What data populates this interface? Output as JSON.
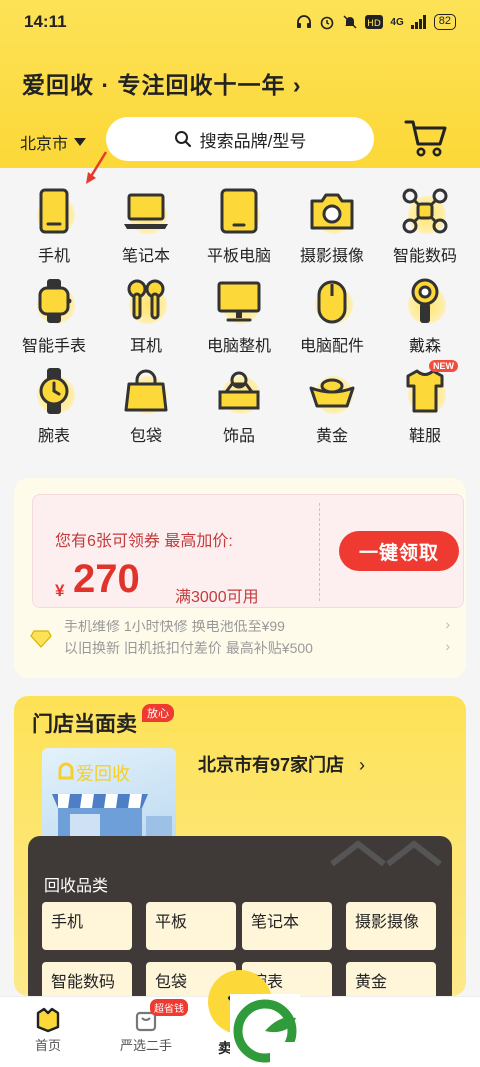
{
  "status_bar": {
    "time": "14:11",
    "network": "4G",
    "battery": "82"
  },
  "header": {
    "slogan": "爱回收 · 专注回收十一年 ›",
    "city": "北京市",
    "search_placeholder": "搜索品牌/型号"
  },
  "categories": [
    {
      "label": "手机",
      "icon": "phone-icon"
    },
    {
      "label": "笔记本",
      "icon": "laptop-icon"
    },
    {
      "label": "平板电脑",
      "icon": "tablet-icon"
    },
    {
      "label": "摄影摄像",
      "icon": "camera-icon"
    },
    {
      "label": "智能数码",
      "icon": "drone-icon"
    },
    {
      "label": "智能手表",
      "icon": "smartwatch-icon"
    },
    {
      "label": "耳机",
      "icon": "earbuds-icon"
    },
    {
      "label": "电脑整机",
      "icon": "desktop-icon"
    },
    {
      "label": "电脑配件",
      "icon": "mouse-icon"
    },
    {
      "label": "戴森",
      "icon": "hairdryer-icon"
    },
    {
      "label": "腕表",
      "icon": "wristwatch-icon"
    },
    {
      "label": "包袋",
      "icon": "handbag-icon"
    },
    {
      "label": "饰品",
      "icon": "ring-box-icon"
    },
    {
      "label": "黄金",
      "icon": "gold-ingot-icon"
    },
    {
      "label": "鞋服",
      "icon": "shirt-icon",
      "badge": "NEW"
    }
  ],
  "coupon": {
    "line1": "您有6张可领券 最高加价:",
    "currency": "¥",
    "amount": "270",
    "condition": "满3000可用",
    "button": "一键领取"
  },
  "ticker": [
    "手机维修 1小时快修 换电池低至¥99",
    "以旧换新 旧机抵扣付差价 最高补贴¥500"
  ],
  "store": {
    "title": "门店当面卖",
    "badge": "放心",
    "image_logo": "爱回收",
    "count_text": "北京市有97家门店",
    "chevron": "›",
    "panel_label": "回收品类",
    "chips": [
      "手机",
      "平板",
      "笔记本",
      "摄影摄像",
      "智能数码",
      "包袋",
      "腕表",
      "黄金"
    ]
  },
  "tabbar": {
    "tabs": [
      {
        "label": "首页",
        "icon": "home-icon"
      },
      {
        "label": "严选二手",
        "icon": "bag-icon",
        "badge": "超省钱"
      },
      {
        "label": "卖",
        "icon": "sell-icon"
      }
    ]
  },
  "colors": {
    "brand_yellow": "#fcd838",
    "accent_red": "#ee3a30",
    "panel_dark": "#3f3a38"
  }
}
